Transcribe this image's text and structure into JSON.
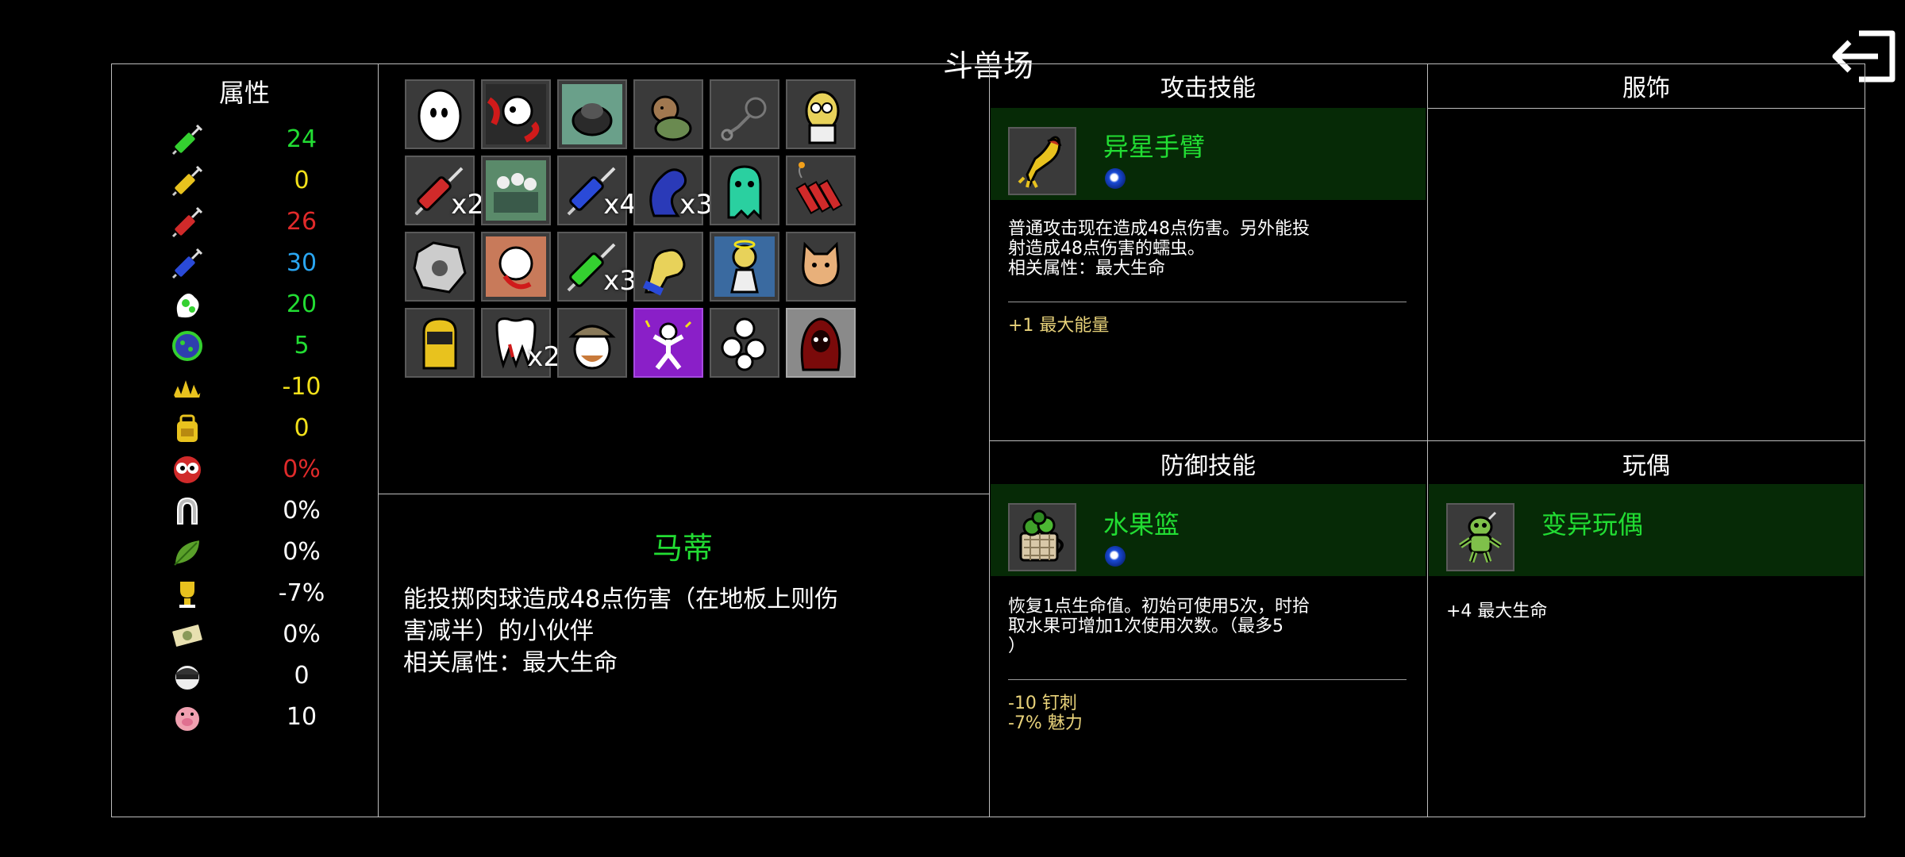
{
  "title": "斗兽场",
  "stats": {
    "title": "属性",
    "rows": [
      {
        "icon": "green-syringe-icon",
        "value": "24",
        "color": "#22dd33"
      },
      {
        "icon": "yellow-syringe-icon",
        "value": "0",
        "color": "#f2e11a"
      },
      {
        "icon": "red-syringe-icon",
        "value": "26",
        "color": "#e02a2a"
      },
      {
        "icon": "blue-syringe-icon",
        "value": "30",
        "color": "#2aa6f2"
      },
      {
        "icon": "green-blob-icon",
        "value": "20",
        "color": "#22dd33"
      },
      {
        "icon": "green-orb-icon",
        "value": "5",
        "color": "#22dd33"
      },
      {
        "icon": "spikes-icon",
        "value": "-10",
        "color": "#f2e11a"
      },
      {
        "icon": "backpack-icon",
        "value": "0",
        "color": "#f2e11a"
      },
      {
        "icon": "eyes-icon",
        "value": "0%",
        "color": "#e02a2a"
      },
      {
        "icon": "horseshoe-icon",
        "value": "0%",
        "color": "#ffffff"
      },
      {
        "icon": "leaf-icon",
        "value": "0%",
        "color": "#ffffff"
      },
      {
        "icon": "trophy-icon",
        "value": "-7%",
        "color": "#ffffff"
      },
      {
        "icon": "money-icon",
        "value": "0%",
        "color": "#ffffff"
      },
      {
        "icon": "thief-icon",
        "value": "0",
        "color": "#ffffff"
      },
      {
        "icon": "pig-icon",
        "value": "10",
        "color": "#ffffff"
      }
    ]
  },
  "items": [
    {
      "icon": "egg-ghost-icon",
      "count": ""
    },
    {
      "icon": "bloody-skull-icon",
      "count": ""
    },
    {
      "icon": "rat-pot-icon",
      "count": ""
    },
    {
      "icon": "bear-turtle-icon",
      "count": ""
    },
    {
      "icon": "chain-mace-icon",
      "count": ""
    },
    {
      "icon": "scientist-icon",
      "count": ""
    },
    {
      "icon": "red-syringe-item-icon",
      "count": "x2"
    },
    {
      "icon": "crowd-icon",
      "count": ""
    },
    {
      "icon": "blue-syringe-item-icon",
      "count": "x4"
    },
    {
      "icon": "blue-blob-icon",
      "count": "x3"
    },
    {
      "icon": "green-ghost-icon",
      "count": ""
    },
    {
      "icon": "dynamite-icon",
      "count": ""
    },
    {
      "icon": "stone-icon",
      "count": ""
    },
    {
      "icon": "bloody-creature-icon",
      "count": ""
    },
    {
      "icon": "green-syringe-item-icon",
      "count": "x3"
    },
    {
      "icon": "muscle-arm-icon",
      "count": ""
    },
    {
      "icon": "angel-icon",
      "count": ""
    },
    {
      "icon": "cat-icon",
      "count": ""
    },
    {
      "icon": "welder-mask-icon",
      "count": ""
    },
    {
      "icon": "tooth-icon",
      "count": "x2"
    },
    {
      "icon": "explorer-icon",
      "count": ""
    },
    {
      "icon": "dancer-icon",
      "count": ""
    },
    {
      "icon": "skulls-pile-icon",
      "count": ""
    },
    {
      "icon": "red-hood-icon",
      "count": ""
    }
  ],
  "companion": {
    "name": "马蒂",
    "description_lines": [
      "能投掷肉球造成48点伤害（在地板上则伤",
      "害减半）的小伙伴",
      "相关属性：最大生命"
    ]
  },
  "attack_skill": {
    "title": "攻击技能",
    "name": "异星手臂",
    "icon": "alien-arm-icon",
    "description_lines": [
      "普通攻击现在造成48点伤害。另外能投",
      "射造成48点伤害的蠕虫。",
      "相关属性：最大生命"
    ],
    "bonuses": [
      "+1 最大能量"
    ]
  },
  "outfit": {
    "title": "服饰"
  },
  "defense_skill": {
    "title": "防御技能",
    "name": "水果篮",
    "icon": "fruit-basket-icon",
    "description_lines": [
      "恢复1点生命值。初始可使用5次，时拾",
      "取水果可增加1次使用次数。（最多5",
      "）"
    ],
    "bonuses": [
      "-10 钉刺",
      "-7% 魅力"
    ]
  },
  "doll": {
    "title": "玩偶",
    "name": "变异玩偶",
    "icon": "mutant-doll-icon",
    "bonus": "+4 最大生命"
  }
}
